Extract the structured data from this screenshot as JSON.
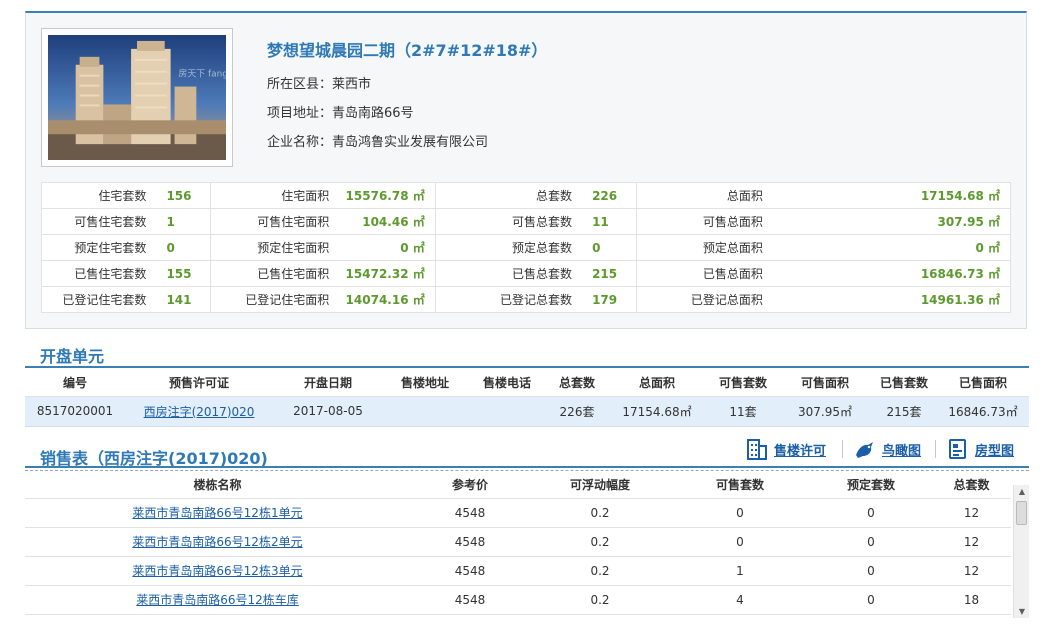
{
  "project": {
    "title": "梦想望城晨园二期（2#7#12#18#）",
    "district": "所在区县：莱西市",
    "address": "项目地址：青岛南路66号",
    "company": "企业名称：青岛鸿鲁实业发展有限公司",
    "photo_watermark": "房天下 fang.com"
  },
  "stats": [
    [
      {
        "label": "住宅套数",
        "value": "156"
      },
      {
        "label": "住宅面积",
        "value": "15576.78 ㎡"
      },
      {
        "label": "总套数",
        "value": "226"
      },
      {
        "label": "总面积",
        "value": "17154.68 ㎡"
      }
    ],
    [
      {
        "label": "可售住宅套数",
        "value": "1"
      },
      {
        "label": "可售住宅面积",
        "value": "104.46 ㎡"
      },
      {
        "label": "可售总套数",
        "value": "11"
      },
      {
        "label": "可售总面积",
        "value": "307.95 ㎡"
      }
    ],
    [
      {
        "label": "预定住宅套数",
        "value": "0"
      },
      {
        "label": "预定住宅面积",
        "value": "0 ㎡"
      },
      {
        "label": "预定总套数",
        "value": "0"
      },
      {
        "label": "预定总面积",
        "value": "0 ㎡"
      }
    ],
    [
      {
        "label": "已售住宅套数",
        "value": "155"
      },
      {
        "label": "已售住宅面积",
        "value": "15472.32 ㎡"
      },
      {
        "label": "已售总套数",
        "value": "215"
      },
      {
        "label": "已售总面积",
        "value": "16846.73 ㎡"
      }
    ],
    [
      {
        "label": "已登记住宅套数",
        "value": "141"
      },
      {
        "label": "已登记住宅面积",
        "value": "14074.16 ㎡"
      },
      {
        "label": "已登记总套数",
        "value": "179"
      },
      {
        "label": "已登记总面积",
        "value": "14961.36 ㎡"
      }
    ]
  ],
  "units_section": {
    "title": "开盘单元",
    "headers": [
      "编号",
      "预售许可证",
      "开盘日期",
      "售楼地址",
      "售楼电话",
      "总套数",
      "总面积",
      "可售套数",
      "可售面积",
      "已售套数",
      "已售面积"
    ],
    "rows": [
      [
        "8517020001",
        "西房注字(2017)020",
        "2017-08-05",
        "",
        "",
        "226套",
        "17154.68㎡",
        "11套",
        "307.95㎡",
        "215套",
        "16846.73㎡"
      ]
    ]
  },
  "sales_section": {
    "title": "销售表（西房注字(2017)020)",
    "tools": {
      "permit": "售楼许可",
      "aerial": "鸟瞰图",
      "floorplan": "房型图"
    },
    "headers": [
      "楼栋名称",
      "参考价",
      "可浮动幅度",
      "可售套数",
      "预定套数",
      "总套数"
    ],
    "rows": [
      [
        "莱西市青岛南路66号12栋1单元",
        "4548",
        "0.2",
        "0",
        "0",
        "12"
      ],
      [
        "莱西市青岛南路66号12栋2单元",
        "4548",
        "0.2",
        "0",
        "0",
        "12"
      ],
      [
        "莱西市青岛南路66号12栋3单元",
        "4548",
        "0.2",
        "1",
        "0",
        "12"
      ],
      [
        "莱西市青岛南路66号12栋车库",
        "4548",
        "0.2",
        "4",
        "0",
        "18"
      ]
    ]
  },
  "colors": {
    "accent": "#2f79b7",
    "value_green": "#5d9a2e",
    "link": "#1b5fa8",
    "row_highlight": "#e2eef9"
  }
}
